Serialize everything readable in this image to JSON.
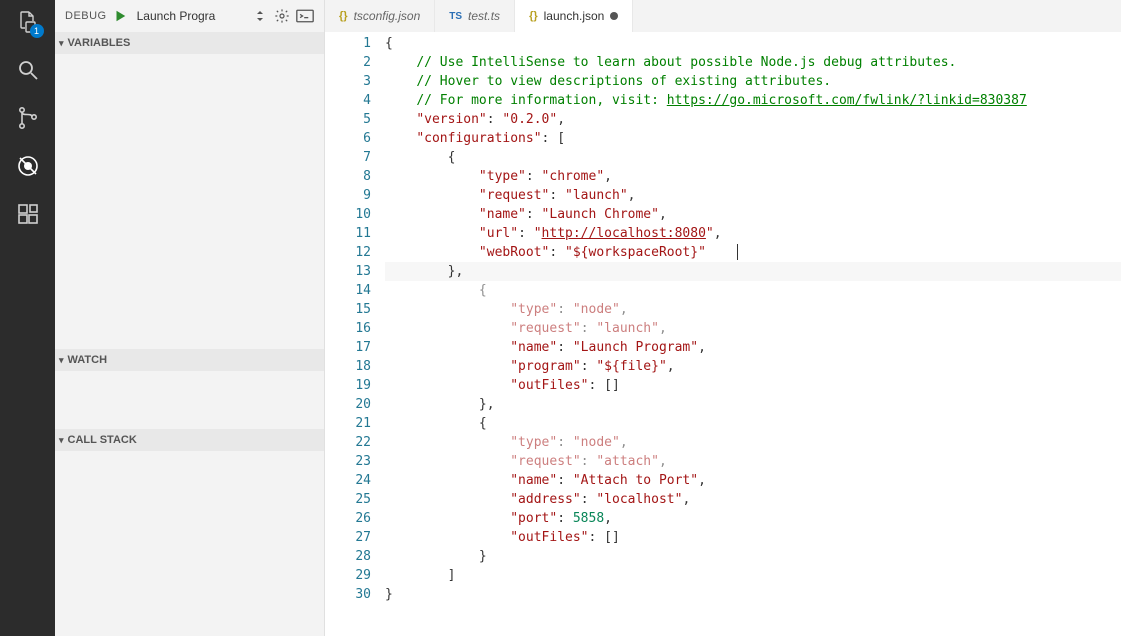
{
  "activity_bar": {
    "explorer_badge": "1"
  },
  "sidebar": {
    "title": "DEBUG",
    "config_selected": "Launch Progra",
    "sections": {
      "variables": "VARIABLES",
      "watch": "WATCH",
      "callstack": "CALL STACK"
    }
  },
  "tabs": [
    {
      "name": "tsconfig.json",
      "icon": "{}",
      "icon_class": "ficon-json",
      "active": false,
      "dirty": false,
      "italic": true
    },
    {
      "name": "test.ts",
      "icon": "TS",
      "icon_class": "ficon-ts",
      "active": false,
      "dirty": false,
      "italic": true
    },
    {
      "name": "launch.json",
      "icon": "{}",
      "icon_class": "ficon-json",
      "active": true,
      "dirty": true,
      "italic": false
    }
  ],
  "editor": {
    "line_count": 30,
    "highlighted_line": 13,
    "lines": [
      [
        {
          "t": "{",
          "c": "punc"
        }
      ],
      [
        {
          "t": "    ",
          "c": "punc"
        },
        {
          "t": "// Use IntelliSense to learn about possible Node.js debug attributes.",
          "c": "comment"
        }
      ],
      [
        {
          "t": "    ",
          "c": "punc"
        },
        {
          "t": "// Hover to view descriptions of existing attributes.",
          "c": "comment"
        }
      ],
      [
        {
          "t": "    ",
          "c": "punc"
        },
        {
          "t": "// For more information, visit: ",
          "c": "comment"
        },
        {
          "t": "https://go.microsoft.com/fwlink/?linkid=830387",
          "c": "link"
        }
      ],
      [
        {
          "t": "    ",
          "c": "punc"
        },
        {
          "t": "\"version\"",
          "c": "key"
        },
        {
          "t": ": ",
          "c": "punc"
        },
        {
          "t": "\"0.2.0\"",
          "c": "str"
        },
        {
          "t": ",",
          "c": "punc"
        }
      ],
      [
        {
          "t": "    ",
          "c": "punc"
        },
        {
          "t": "\"configurations\"",
          "c": "key"
        },
        {
          "t": ": [",
          "c": "punc"
        }
      ],
      [
        {
          "t": "        {",
          "c": "punc"
        }
      ],
      [
        {
          "t": "            ",
          "c": "punc"
        },
        {
          "t": "\"type\"",
          "c": "key"
        },
        {
          "t": ": ",
          "c": "punc"
        },
        {
          "t": "\"chrome\"",
          "c": "str"
        },
        {
          "t": ",",
          "c": "punc"
        }
      ],
      [
        {
          "t": "            ",
          "c": "punc"
        },
        {
          "t": "\"request\"",
          "c": "key"
        },
        {
          "t": ": ",
          "c": "punc"
        },
        {
          "t": "\"launch\"",
          "c": "str"
        },
        {
          "t": ",",
          "c": "punc"
        }
      ],
      [
        {
          "t": "            ",
          "c": "punc"
        },
        {
          "t": "\"name\"",
          "c": "key"
        },
        {
          "t": ": ",
          "c": "punc"
        },
        {
          "t": "\"Launch Chrome\"",
          "c": "str"
        },
        {
          "t": ",",
          "c": "punc"
        }
      ],
      [
        {
          "t": "            ",
          "c": "punc"
        },
        {
          "t": "\"url\"",
          "c": "key"
        },
        {
          "t": ": ",
          "c": "punc"
        },
        {
          "t": "\"",
          "c": "str"
        },
        {
          "t": "http://localhost:8080",
          "c": "str-url"
        },
        {
          "t": "\"",
          "c": "str"
        },
        {
          "t": ",",
          "c": "punc"
        }
      ],
      [
        {
          "t": "            ",
          "c": "punc"
        },
        {
          "t": "\"webRoot\"",
          "c": "key"
        },
        {
          "t": ": ",
          "c": "punc"
        },
        {
          "t": "\"${workspaceRoot}\"",
          "c": "str"
        }
      ],
      [
        {
          "t": "        },",
          "c": "punc"
        }
      ],
      [
        {
          "t": "            {",
          "c": "punc muted"
        }
      ],
      [
        {
          "t": "                ",
          "c": "punc"
        },
        {
          "t": "\"type\"",
          "c": "key muted"
        },
        {
          "t": ": ",
          "c": "punc muted"
        },
        {
          "t": "\"node\"",
          "c": "str muted"
        },
        {
          "t": ",",
          "c": "punc muted"
        }
      ],
      [
        {
          "t": "                ",
          "c": "punc"
        },
        {
          "t": "\"request\"",
          "c": "key muted"
        },
        {
          "t": ": ",
          "c": "punc muted"
        },
        {
          "t": "\"launch\"",
          "c": "str muted"
        },
        {
          "t": ",",
          "c": "punc muted"
        }
      ],
      [
        {
          "t": "                ",
          "c": "punc"
        },
        {
          "t": "\"name\"",
          "c": "key"
        },
        {
          "t": ": ",
          "c": "punc"
        },
        {
          "t": "\"Launch Program\"",
          "c": "str"
        },
        {
          "t": ",",
          "c": "punc"
        }
      ],
      [
        {
          "t": "                ",
          "c": "punc"
        },
        {
          "t": "\"program\"",
          "c": "key"
        },
        {
          "t": ": ",
          "c": "punc"
        },
        {
          "t": "\"${file}\"",
          "c": "str"
        },
        {
          "t": ",",
          "c": "punc"
        }
      ],
      [
        {
          "t": "                ",
          "c": "punc"
        },
        {
          "t": "\"outFiles\"",
          "c": "key"
        },
        {
          "t": ": []",
          "c": "punc"
        }
      ],
      [
        {
          "t": "            },",
          "c": "punc"
        }
      ],
      [
        {
          "t": "            {",
          "c": "punc"
        }
      ],
      [
        {
          "t": "                ",
          "c": "punc"
        },
        {
          "t": "\"type\"",
          "c": "key muted"
        },
        {
          "t": ": ",
          "c": "punc muted"
        },
        {
          "t": "\"node\"",
          "c": "str muted"
        },
        {
          "t": ",",
          "c": "punc muted"
        }
      ],
      [
        {
          "t": "                ",
          "c": "punc"
        },
        {
          "t": "\"request\"",
          "c": "key muted"
        },
        {
          "t": ": ",
          "c": "punc muted"
        },
        {
          "t": "\"attach\"",
          "c": "str muted"
        },
        {
          "t": ",",
          "c": "punc muted"
        }
      ],
      [
        {
          "t": "                ",
          "c": "punc"
        },
        {
          "t": "\"name\"",
          "c": "key"
        },
        {
          "t": ": ",
          "c": "punc"
        },
        {
          "t": "\"Attach to Port\"",
          "c": "str"
        },
        {
          "t": ",",
          "c": "punc"
        }
      ],
      [
        {
          "t": "                ",
          "c": "punc"
        },
        {
          "t": "\"address\"",
          "c": "key"
        },
        {
          "t": ": ",
          "c": "punc"
        },
        {
          "t": "\"localhost\"",
          "c": "str"
        },
        {
          "t": ",",
          "c": "punc"
        }
      ],
      [
        {
          "t": "                ",
          "c": "punc"
        },
        {
          "t": "\"port\"",
          "c": "key"
        },
        {
          "t": ": ",
          "c": "punc"
        },
        {
          "t": "5858",
          "c": "num"
        },
        {
          "t": ",",
          "c": "punc"
        }
      ],
      [
        {
          "t": "                ",
          "c": "punc"
        },
        {
          "t": "\"outFiles\"",
          "c": "key"
        },
        {
          "t": ": []",
          "c": "punc"
        }
      ],
      [
        {
          "t": "            }",
          "c": "punc"
        }
      ],
      [
        {
          "t": "        ]",
          "c": "punc"
        }
      ],
      [
        {
          "t": "}",
          "c": "punc"
        }
      ]
    ]
  }
}
